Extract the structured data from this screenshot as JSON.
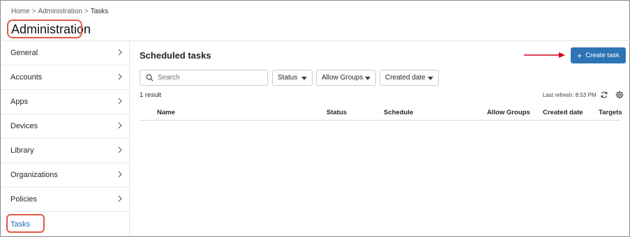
{
  "breadcrumb": {
    "items": [
      "Home",
      "Administration",
      "Tasks"
    ],
    "separator": ">"
  },
  "page_title": "Administration",
  "sidebar": {
    "items": [
      {
        "label": "General",
        "chevron": true
      },
      {
        "label": "Accounts",
        "chevron": true
      },
      {
        "label": "Apps",
        "chevron": true
      },
      {
        "label": "Devices",
        "chevron": true
      },
      {
        "label": "Library",
        "chevron": true
      },
      {
        "label": "Organizations",
        "chevron": true
      },
      {
        "label": "Policies",
        "chevron": true
      },
      {
        "label": "Tasks",
        "chevron": false,
        "active": true
      }
    ]
  },
  "main": {
    "title": "Scheduled tasks",
    "create_button": {
      "label": "Create task",
      "icon": "plus-icon"
    },
    "search": {
      "placeholder": "Search",
      "value": ""
    },
    "filters": [
      {
        "label": "Status"
      },
      {
        "label": "Allow Groups"
      },
      {
        "label": "Created date"
      }
    ],
    "result_count": "1 result",
    "last_refresh": "Last refresh: 8:53 PM",
    "table": {
      "columns": [
        "Name",
        "Status",
        "Schedule",
        "Allow Groups",
        "Created date",
        "Targets"
      ],
      "rows": []
    }
  },
  "colors": {
    "accent": "#2e74b5",
    "active_link": "#1f6fb8",
    "annotation": "#e05a45",
    "arrow": "#d0021b"
  }
}
